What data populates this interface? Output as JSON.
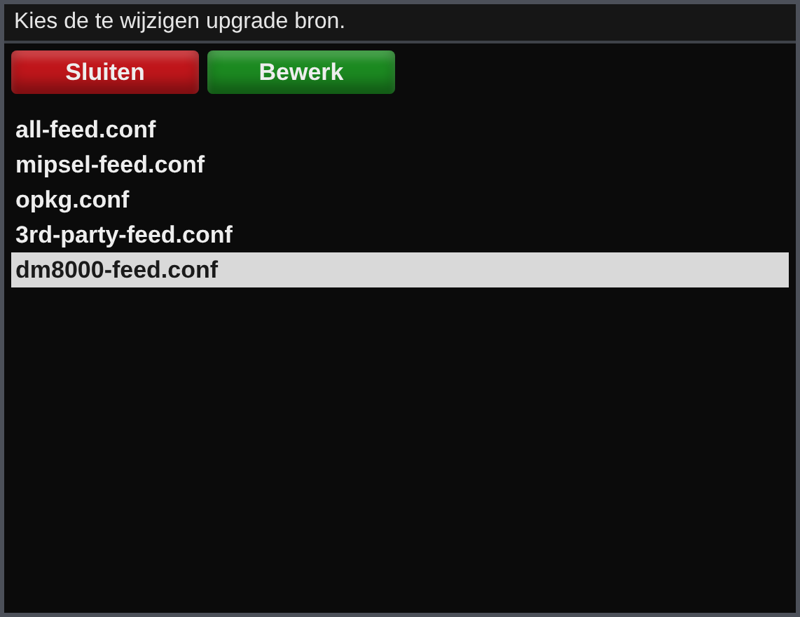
{
  "window": {
    "title": "Kies de te wijzigen upgrade bron."
  },
  "buttons": [
    {
      "label": "Sluiten",
      "color": "#c0161b"
    },
    {
      "label": "Bewerk",
      "color": "#1c8a21"
    }
  ],
  "list": [
    {
      "label": "all-feed.conf",
      "selected": false
    },
    {
      "label": "mipsel-feed.conf",
      "selected": false
    },
    {
      "label": "opkg.conf",
      "selected": false
    },
    {
      "label": "3rd-party-feed.conf",
      "selected": false
    },
    {
      "label": "dm8000-feed.conf",
      "selected": true
    }
  ]
}
